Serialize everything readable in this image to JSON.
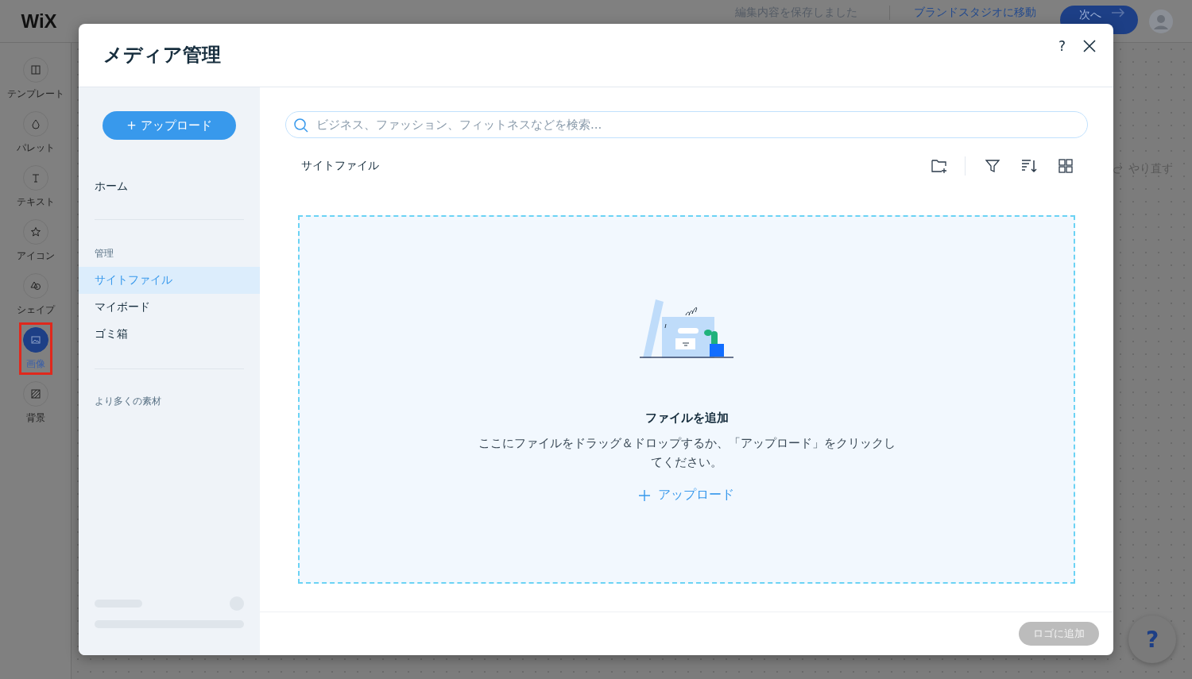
{
  "editor": {
    "logo": "WiX",
    "status": "編集内容を保存しました",
    "brand_link": "ブランドスタジオに移動",
    "next_button": "次へ",
    "redo": "やり直す",
    "help": "?",
    "sidebar": [
      {
        "label": "テンプレート",
        "selected": false
      },
      {
        "label": "パレット",
        "selected": false
      },
      {
        "label": "テキスト",
        "selected": false
      },
      {
        "label": "アイコン",
        "selected": false
      },
      {
        "label": "シェイプ",
        "selected": false
      },
      {
        "label": "画像",
        "selected": true
      },
      {
        "label": "背景",
        "selected": false
      }
    ]
  },
  "dialog": {
    "title": "メディア管理",
    "help": "?",
    "upload_button": "+ アップロード",
    "nav_groups": [
      {
        "items": [
          {
            "label": "ホーム",
            "selected": false
          }
        ]
      },
      {
        "heading": "管理",
        "items": [
          {
            "label": "サイトファイル",
            "selected": true
          },
          {
            "label": "マイボード",
            "selected": false
          },
          {
            "label": "ゴミ箱",
            "selected": false
          }
        ]
      },
      {
        "heading": "より多くの素材"
      }
    ],
    "search": {
      "placeholder": "ビジネス、ファッション、フィットネスなどを検索..."
    },
    "folder": "サイトファイル",
    "dropzone": {
      "title": "ファイルを追加",
      "text": "ここにファイルをドラッグ＆ドロップするか、「アップロード」をクリックしてください。",
      "link": "アップロード"
    },
    "footer_button": {
      "label": "ロゴに追加",
      "disabled": true
    }
  }
}
